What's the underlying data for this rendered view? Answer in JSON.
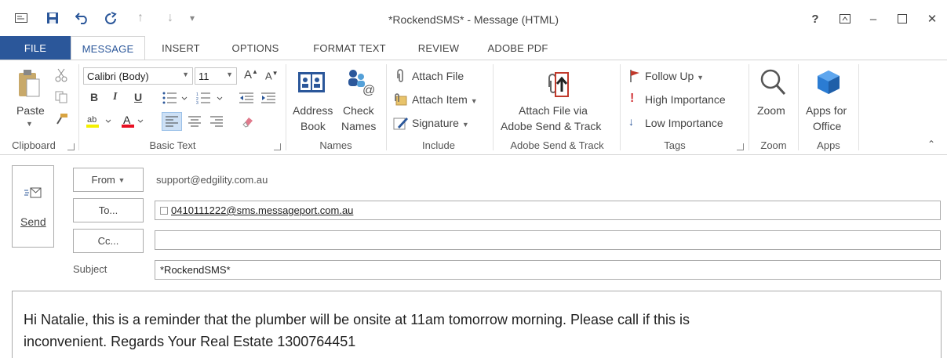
{
  "window": {
    "title": "*RockendSMS* - Message (HTML)"
  },
  "qat": {
    "save_icon": "save-icon",
    "undo_icon": "undo-icon",
    "redo_icon": "redo-icon",
    "up_icon": "up-arrow-icon",
    "down_icon": "down-arrow-icon",
    "customize": "▾"
  },
  "window_controls": {
    "help": "?",
    "restore_ribbon": "⊼",
    "minimize": "–",
    "maximize": "☐",
    "close": "✕"
  },
  "tabs": [
    {
      "label": "FILE"
    },
    {
      "label": "MESSAGE"
    },
    {
      "label": "INSERT"
    },
    {
      "label": "OPTIONS"
    },
    {
      "label": "FORMAT TEXT"
    },
    {
      "label": "REVIEW"
    },
    {
      "label": "ADOBE PDF"
    }
  ],
  "ribbon": {
    "clipboard": {
      "label": "Clipboard",
      "paste": "Paste"
    },
    "basic_text": {
      "label": "Basic Text",
      "font": "Calibri (Body)",
      "size": "11",
      "bold": "B",
      "italic": "I",
      "underline": "U"
    },
    "names": {
      "label": "Names",
      "address_book_1": "Address",
      "address_book_2": "Book",
      "check_names_1": "Check",
      "check_names_2": "Names"
    },
    "include": {
      "label": "Include",
      "attach_file": "Attach File",
      "attach_item": "Attach Item",
      "signature": "Signature"
    },
    "adobe": {
      "label": "Adobe Send & Track",
      "line1": "Attach File via",
      "line2": "Adobe Send & Track"
    },
    "tags": {
      "label": "Tags",
      "follow_up": "Follow Up",
      "high": "High Importance",
      "low": "Low Importance"
    },
    "zoom": {
      "label": "Zoom",
      "button": "Zoom"
    },
    "apps": {
      "label": "Apps",
      "line1": "Apps for",
      "line2": "Office"
    }
  },
  "form": {
    "send": "Send",
    "from_label": "From",
    "from_value": "support@edgility.com.au",
    "to_label": "To...",
    "to_value": "0410111222@sms.messageport.com.au",
    "cc_label": "Cc...",
    "cc_value": "",
    "subject_label": "Subject",
    "subject_value": "*RockendSMS*"
  },
  "message_body": {
    "line1": "Hi Natalie, this is a reminder that the plumber will be onsite at 11am tomorrow morning. Please call if this is",
    "line2": "inconvenient. Regards Your Real Estate 1300764451"
  },
  "colors": {
    "accent": "#2b579a",
    "border": "#ababab",
    "follow_up": "#c0392b",
    "high_importance": "#d13438",
    "low_importance": "#2b579a"
  }
}
